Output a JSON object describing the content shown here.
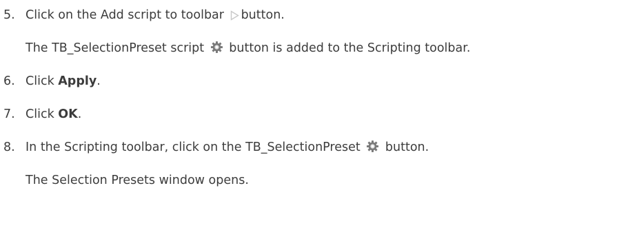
{
  "steps": [
    {
      "number": "5.",
      "text_before": "Click on the Add script to toolbar",
      "icon": "play-triangle-icon",
      "text_after": "button.",
      "note_before": "The TB_SelectionPreset script",
      "note_icon": "gear-icon",
      "note_after": "button is added to the Scripting toolbar."
    },
    {
      "number": "6.",
      "text_before": "Click ",
      "bold": "Apply",
      "text_after": "."
    },
    {
      "number": "7.",
      "text_before": "Click ",
      "bold": "OK",
      "text_after": "."
    },
    {
      "number": "8.",
      "text_before": "In the Scripting toolbar, click on the TB_SelectionPreset",
      "icon": "gear-icon",
      "text_after": "button.",
      "note": "The Selection Presets window opens."
    }
  ],
  "colors": {
    "text": "#3c3c3c",
    "icon_triangle": "#c8c8c8",
    "gear": "#7a7a7a"
  }
}
